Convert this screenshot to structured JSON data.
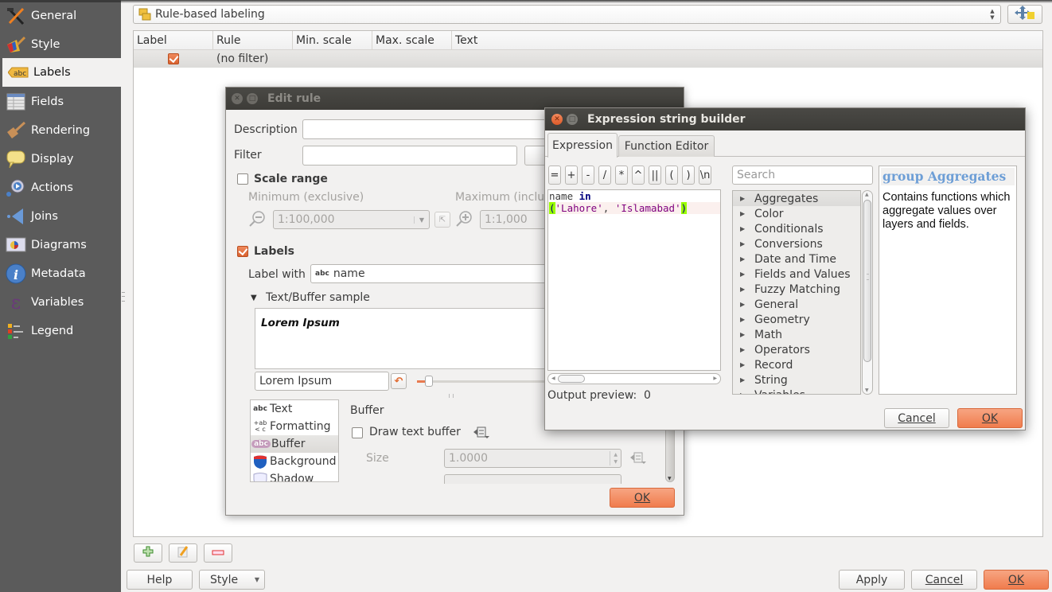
{
  "sidebar": {
    "items": [
      {
        "label": "General",
        "icon": "hammer-wrench-icon"
      },
      {
        "label": "Style",
        "icon": "paintbrush-icon"
      },
      {
        "label": "Labels",
        "icon": "abc-label-icon",
        "active": true
      },
      {
        "label": "Fields",
        "icon": "table-icon"
      },
      {
        "label": "Rendering",
        "icon": "brush-icon"
      },
      {
        "label": "Display",
        "icon": "speech-bubble-icon"
      },
      {
        "label": "Actions",
        "icon": "gear-play-icon"
      },
      {
        "label": "Joins",
        "icon": "join-icon"
      },
      {
        "label": "Diagrams",
        "icon": "diagram-icon"
      },
      {
        "label": "Metadata",
        "icon": "info-icon"
      },
      {
        "label": "Variables",
        "icon": "epsilon-icon"
      },
      {
        "label": "Legend",
        "icon": "legend-icon"
      }
    ]
  },
  "main": {
    "labeling_mode": "Rule-based labeling",
    "table": {
      "columns": [
        "Label",
        "Rule",
        "Min. scale",
        "Max. scale",
        "Text"
      ],
      "rows": [
        {
          "label_checked": true,
          "rule": "(no filter)",
          "min_scale": "",
          "max_scale": "",
          "text": ""
        }
      ]
    },
    "buttons": {
      "help": "Help",
      "style": "Style",
      "apply": "Apply",
      "cancel": "Cancel",
      "ok": "OK"
    }
  },
  "edit_rule": {
    "title": "Edit rule",
    "description_label": "Description",
    "description_value": "",
    "filter_label": "Filter",
    "filter_value": "",
    "scale_range_label": "Scale range",
    "scale_range_checked": false,
    "minimum_label": "Minimum (exclusive)",
    "maximum_label": "Maximum (inclus",
    "minimum_value": "1:100,000",
    "maximum_value": "1:1,000",
    "labels_label": "Labels",
    "labels_checked": true,
    "label_with_label": "Label with",
    "label_with_value": "name",
    "sample_header": "Text/Buffer sample",
    "sample_text": "Lorem Ipsum",
    "sample_input": "Lorem Ipsum",
    "sections": [
      "Text",
      "Formatting",
      "Buffer",
      "Background",
      "Shadow"
    ],
    "selected_section": "Buffer",
    "buffer_heading": "Buffer",
    "draw_buffer_label": "Draw text buffer",
    "draw_buffer_checked": false,
    "size_label": "Size",
    "size_value": "1.0000",
    "ok": "OK"
  },
  "expression_builder": {
    "title": "Expression string builder",
    "tabs": [
      "Expression",
      "Function Editor"
    ],
    "active_tab": "Expression",
    "operators": [
      "=",
      "+",
      "-",
      "/",
      "*",
      "^",
      "||",
      "(",
      ")",
      "\\n"
    ],
    "code_line1_a": "name ",
    "code_line1_kw": "in",
    "code_line2_open": "(",
    "code_line2_str1": "'Lahore'",
    "code_line2_sep": ", ",
    "code_line2_str2": "'Islamabad'",
    "code_line2_close": ")",
    "search_placeholder": "Search",
    "groups": [
      "Aggregates",
      "Color",
      "Conditionals",
      "Conversions",
      "Date and Time",
      "Fields and Values",
      "Fuzzy Matching",
      "General",
      "Geometry",
      "Math",
      "Operators",
      "Record",
      "String",
      "Variables"
    ],
    "selected_group": "Aggregates",
    "help_title": "group Aggregates",
    "help_text": "Contains functions which aggregate values over layers and fields.",
    "output_preview_label": "Output preview:",
    "output_preview_value": "0",
    "cancel": "Cancel",
    "ok": "OK"
  }
}
